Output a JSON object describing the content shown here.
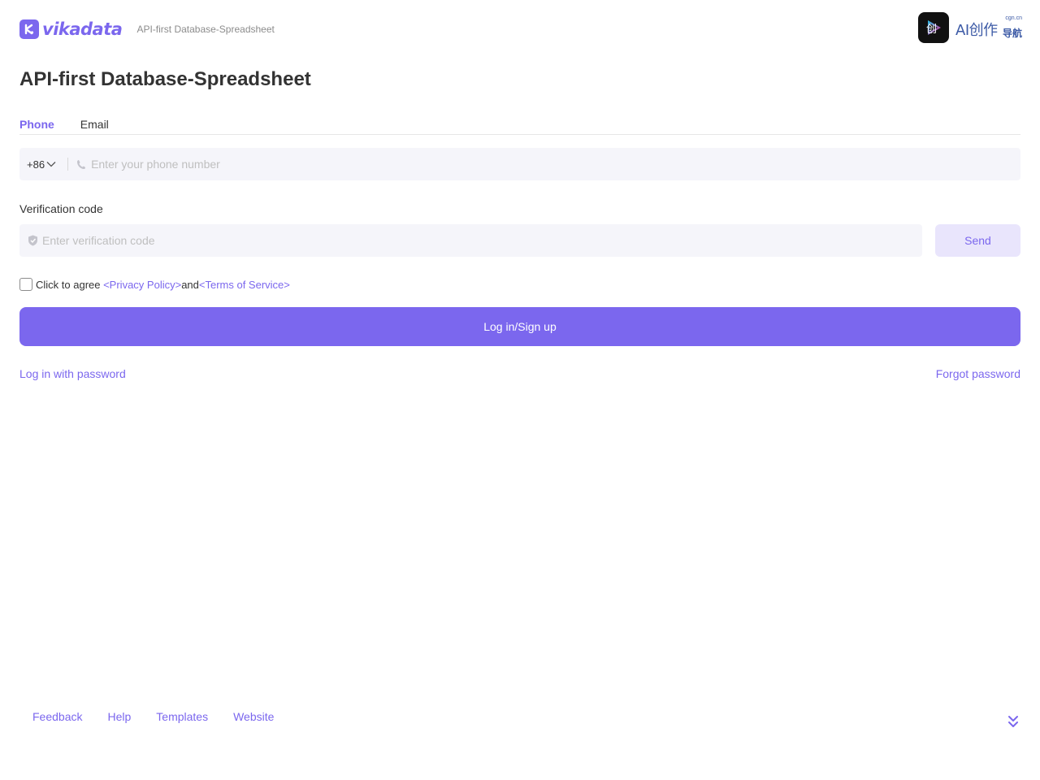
{
  "header": {
    "brand": "vikadata",
    "tagline": "API-first Database-Spreadsheet",
    "badge": {
      "main": "AI创作",
      "small": "cgn.cn",
      "sub": "导航"
    }
  },
  "page_title": "API-first Database-Spreadsheet",
  "tabs": [
    {
      "label": "Phone",
      "active": true
    },
    {
      "label": "Email",
      "active": false
    }
  ],
  "phone": {
    "country_code": "+86",
    "placeholder": "Enter your phone number",
    "value": ""
  },
  "verification": {
    "label": "Verification code",
    "placeholder": "Enter verification code",
    "value": "",
    "send_label": "Send"
  },
  "agreement": {
    "prefix": "Click to agree ",
    "privacy": "<Privacy Policy>",
    "and": "and",
    "terms": "<Terms of Service>",
    "checked": false
  },
  "submit_label": "Log in/Sign up",
  "links": {
    "password_login": "Log in with password",
    "forgot_password": "Forgot password"
  },
  "footer": {
    "links": [
      "Feedback",
      "Help",
      "Templates",
      "Website"
    ]
  },
  "colors": {
    "accent": "#7B67EE",
    "accent_light": "#E9E5FC",
    "input_bg": "#F5F5FA",
    "text": "#333333"
  }
}
